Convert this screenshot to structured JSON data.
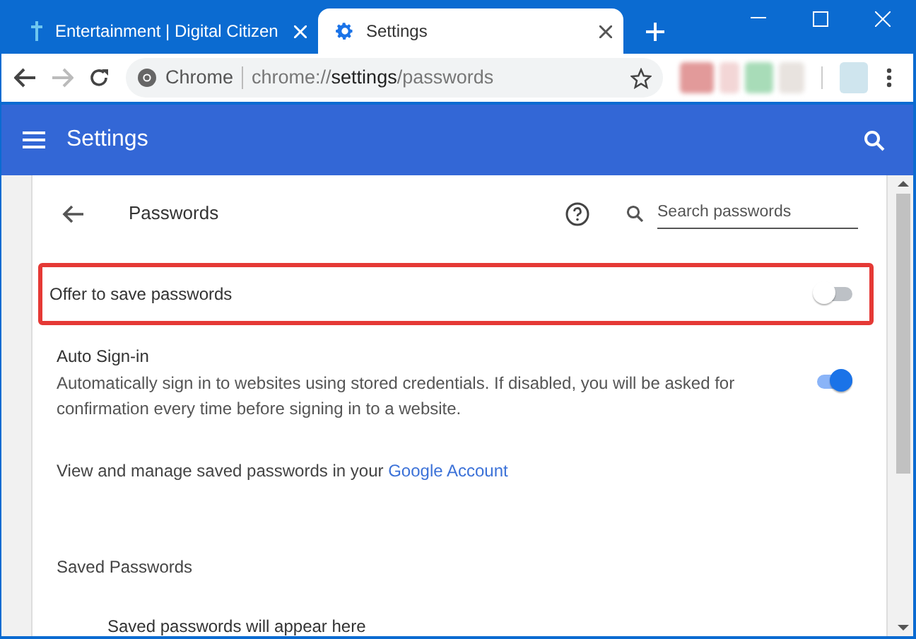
{
  "tabs": [
    {
      "title": "Entertainment | Digital Citizen",
      "kind": "site",
      "selected": false
    },
    {
      "title": "Settings",
      "kind": "settings",
      "selected": true
    }
  ],
  "omnibox": {
    "site_label": "Chrome",
    "url_scheme": "chrome://",
    "url_host": "settings",
    "url_path": "/passwords"
  },
  "header": {
    "title": "Settings"
  },
  "page": {
    "title": "Passwords",
    "search": {
      "placeholder": "Search passwords"
    },
    "offer_to_save": {
      "label": "Offer to save passwords",
      "on": false,
      "highlighted": true
    },
    "auto_sign_in": {
      "label": "Auto Sign-in",
      "description": "Automatically sign in to websites using stored credentials. If disabled, you will be asked for confirmation every time before signing in to a website.",
      "on": true
    },
    "manage": {
      "text": "View and manage saved passwords in your",
      "link": "Google Account"
    },
    "saved_passwords": {
      "heading": "Saved Passwords",
      "empty_message": "Saved passwords will appear here"
    }
  }
}
